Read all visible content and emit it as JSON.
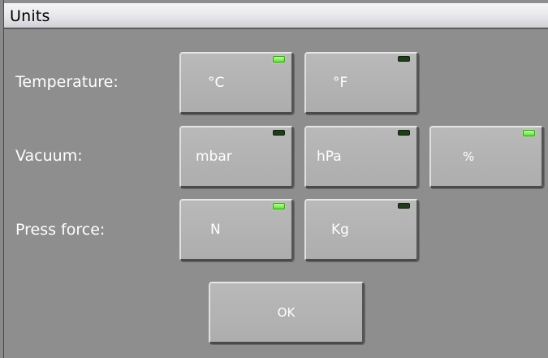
{
  "window": {
    "title": "Units"
  },
  "rows": {
    "temperature": {
      "label": "Temperature:",
      "options": [
        {
          "label": "°C",
          "selected": true
        },
        {
          "label": "°F",
          "selected": false
        }
      ]
    },
    "vacuum": {
      "label": "Vacuum:",
      "options": [
        {
          "label": "mbar",
          "selected": false
        },
        {
          "label": "hPa",
          "selected": false
        },
        {
          "label": "%",
          "selected": true
        }
      ]
    },
    "press_force": {
      "label": "Press force:",
      "options": [
        {
          "label": "N",
          "selected": true
        },
        {
          "label": "Kg",
          "selected": false
        }
      ]
    }
  },
  "ok_button": {
    "label": "OK"
  },
  "colors": {
    "background": "#8e8e8e",
    "button": "#b3b3b3",
    "led_on": "#62e23c",
    "led_off": "#1f3d1a",
    "text": "#ffffff"
  }
}
